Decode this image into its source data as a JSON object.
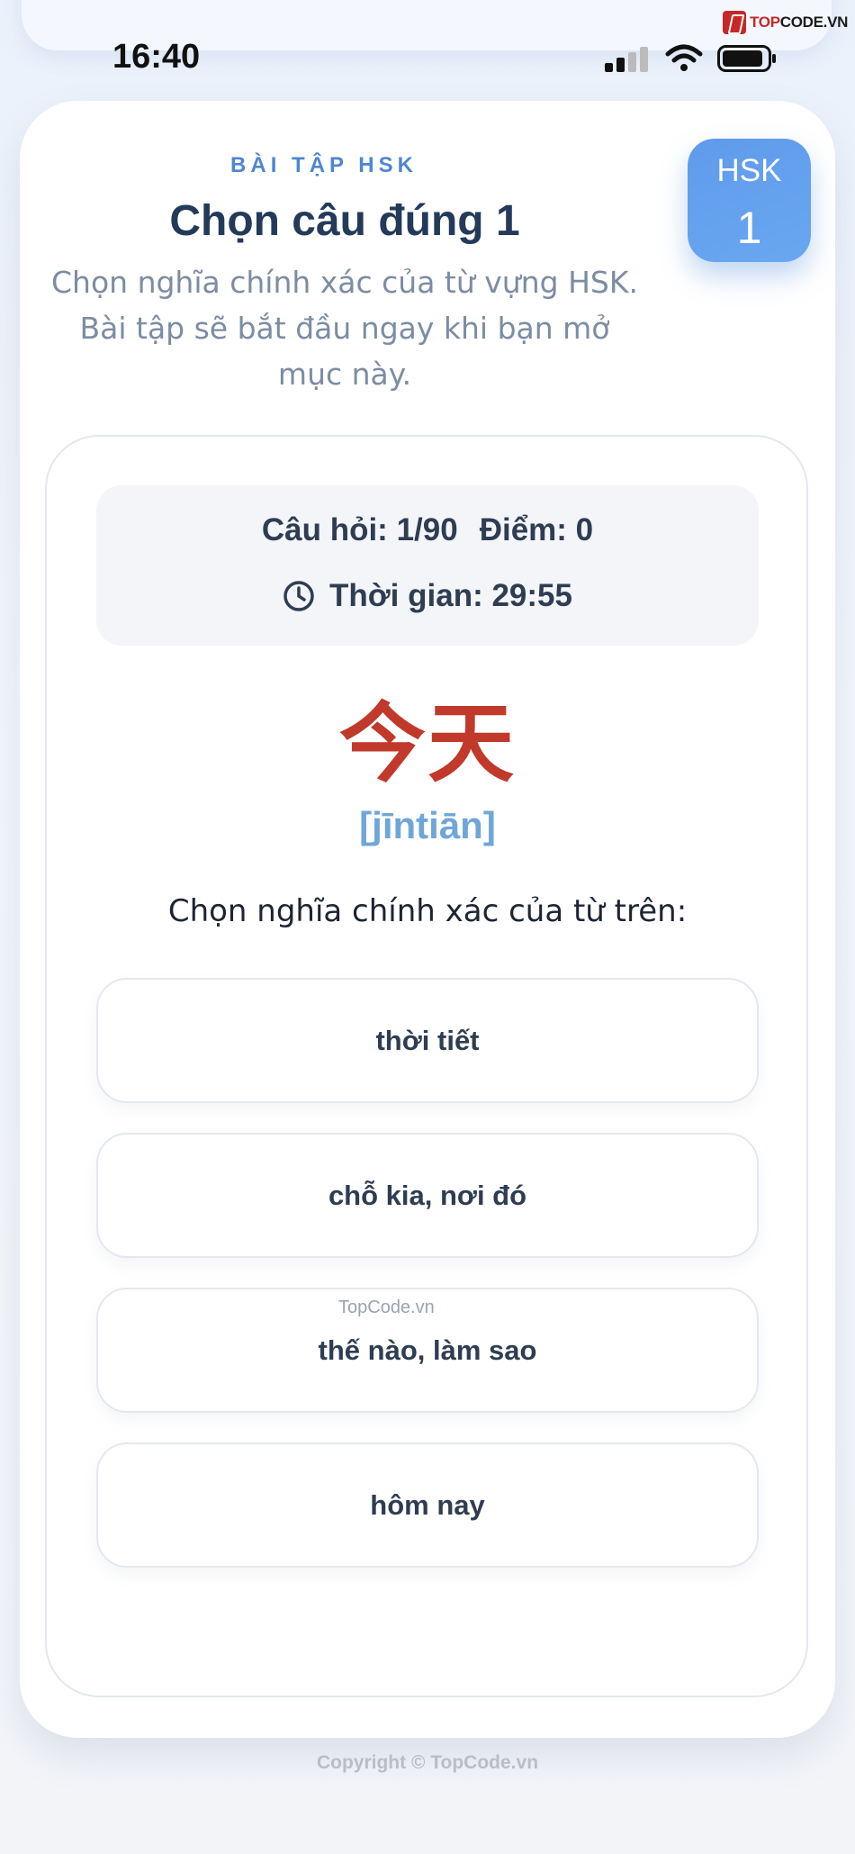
{
  "watermark": {
    "logo_prefix": "TOP",
    "logo_suffix": "CODE.VN",
    "middle": "TopCode.vn"
  },
  "status_bar": {
    "time": "16:40"
  },
  "header": {
    "kicker": "BÀI TẬP HSK",
    "title": "Chọn câu đúng 1",
    "description": "Chọn nghĩa chính xác của từ vựng HSK. Bài tập sẽ bắt đầu ngay khi bạn mở mục này."
  },
  "badge": {
    "label": "HSK",
    "level": "1"
  },
  "quiz": {
    "question_label": "Câu hỏi: 1/90",
    "score_label": "Điểm: 0",
    "timer_label": "Thời gian: 29:55",
    "word": "今天",
    "pinyin": "[jīntiān]",
    "prompt": "Chọn nghĩa chính xác của từ trên:",
    "options": [
      "thời tiết",
      "chỗ kia, nơi đó",
      "thế nào, làm sao",
      "hôm nay"
    ]
  },
  "footer": {
    "copyright": "Copyright © TopCode.vn"
  },
  "colors": {
    "accent": "#5f9bea",
    "hanzi": "#c0392b",
    "pinyin": "#6fa6d8",
    "title": "#243a5a"
  }
}
